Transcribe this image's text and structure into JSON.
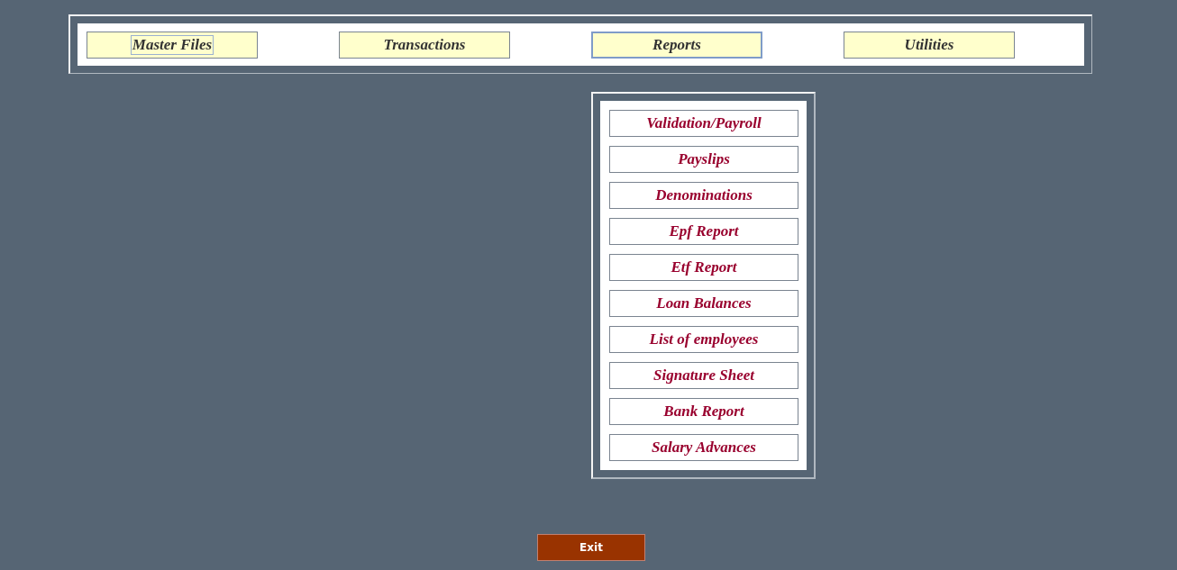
{
  "menu_bar": [
    {
      "label": "Master Files",
      "selected": false,
      "focused": true
    },
    {
      "label": "Transactions",
      "selected": false,
      "focused": false
    },
    {
      "label": "Reports",
      "selected": true,
      "focused": false
    },
    {
      "label": "Utilities",
      "selected": false,
      "focused": false
    }
  ],
  "submenu": {
    "items": [
      "Validation/Payroll",
      "Payslips",
      "Denominations",
      "Epf Report",
      "Etf Report",
      "Loan Balances",
      "List of employees",
      "Signature Sheet",
      "Bank Report",
      "Salary Advances"
    ]
  },
  "exit_button": "Exit"
}
